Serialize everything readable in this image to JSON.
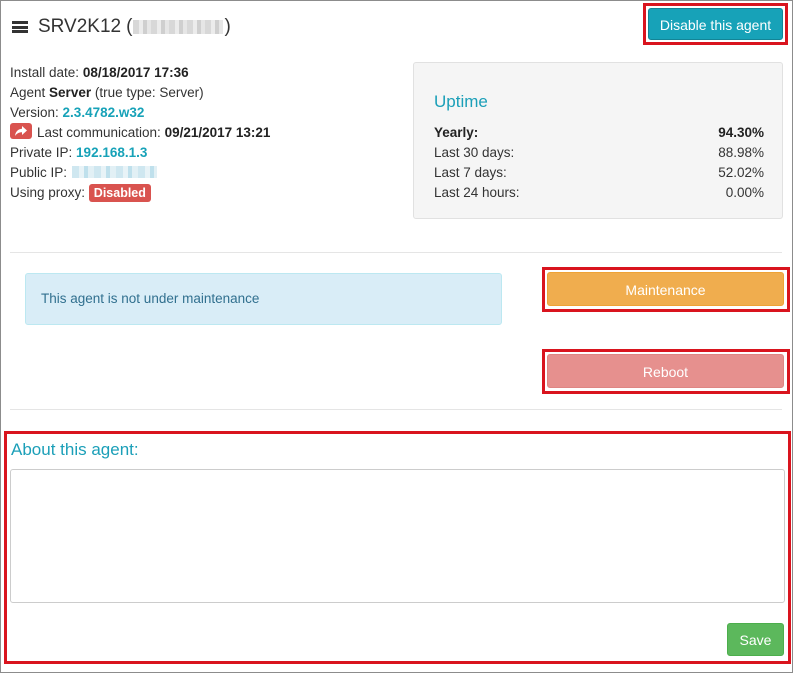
{
  "header": {
    "agent_name": "SRV2K12",
    "open_paren": "(",
    "close_paren": ")",
    "disable_button": "Disable this agent"
  },
  "info": {
    "install_label": "Install date:",
    "install_value": "08/18/2017 17:36",
    "agent_prefix": "Agent",
    "agent_type": "Server",
    "agent_true_type": "(true type: Server)",
    "version_label": "Version:",
    "version_value": "2.3.4782.w32",
    "last_comm_label": "Last communication:",
    "last_comm_value": "09/21/2017 13:21",
    "private_ip_label": "Private IP:",
    "private_ip_value": "192.168.1.3",
    "public_ip_label": "Public IP:",
    "proxy_label": "Using proxy:",
    "proxy_value": "Disabled"
  },
  "uptime": {
    "title": "Uptime",
    "rows": [
      {
        "label": "Yearly:",
        "value": "94.30%"
      },
      {
        "label": "Last 30 days:",
        "value": "88.98%"
      },
      {
        "label": "Last 7 days:",
        "value": "52.02%"
      },
      {
        "label": "Last 24 hours:",
        "value": "0.00%"
      }
    ]
  },
  "maintenance": {
    "status_text": "This agent is not under maintenance",
    "maintenance_button": "Maintenance",
    "reboot_button": "Reboot"
  },
  "about": {
    "label": "About this agent:",
    "text_value": "",
    "save_button": "Save"
  },
  "colors": {
    "accent": "#17a2b8",
    "warning": "#f0ad4e",
    "danger": "#d9534f",
    "success": "#5cb85c",
    "highlight": "#d9141e"
  }
}
